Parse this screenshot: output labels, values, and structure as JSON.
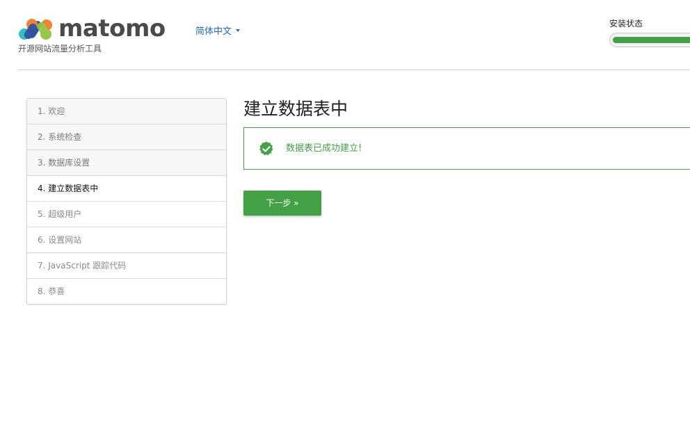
{
  "header": {
    "logo_icon": "matomo-logo-icon",
    "logo_text": "matomo",
    "tagline": "开源网站流量分析工具",
    "language": "简体中文",
    "install_status_label": "安装状态",
    "install_progress": 0.5
  },
  "steps": [
    {
      "label": "1. 欢迎",
      "state": "done"
    },
    {
      "label": "2. 系统检查",
      "state": "done"
    },
    {
      "label": "3. 数据库设置",
      "state": "done"
    },
    {
      "label": "4. 建立数据表中",
      "state": "current"
    },
    {
      "label": "5. 超级用户",
      "state": "todo"
    },
    {
      "label": "6. 设置网站",
      "state": "todo"
    },
    {
      "label": "7. JavaScript 跟踪代码",
      "state": "todo"
    },
    {
      "label": "8. 恭喜",
      "state": "todo"
    }
  ],
  "main": {
    "title": "建立数据表中",
    "success_message": "数据表已成功建立!",
    "success_icon": "check-badge-icon",
    "next_button": "下一步 »"
  },
  "colors": {
    "accent_green": "#43a047",
    "link_blue": "#1e6fb5"
  }
}
